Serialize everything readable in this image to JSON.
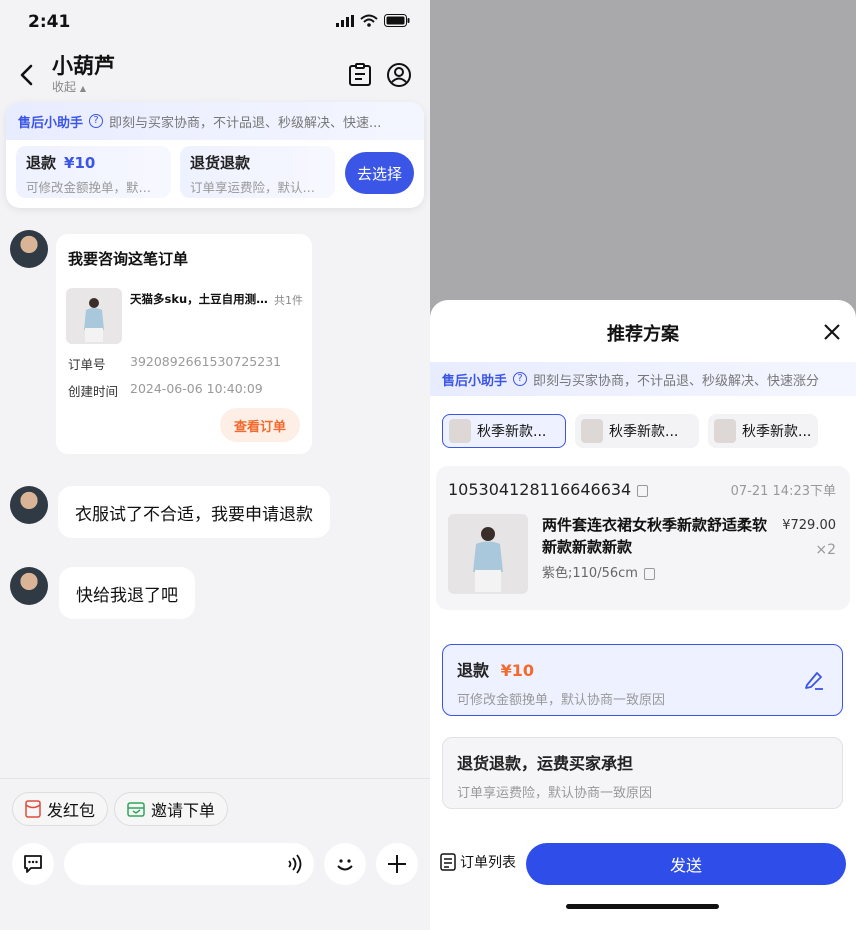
{
  "status_bar": {
    "time": "2:41"
  },
  "header": {
    "title": "小葫芦",
    "subtitle": "收起"
  },
  "helper": {
    "name": "售后小助手",
    "desc": "即刻与买家协商，不计品退、秒级解决、快速...",
    "options": [
      {
        "title": "退款",
        "amount": "¥10",
        "desc": "可修改金额挽单，默认协商一致原因"
      },
      {
        "title": "退货退款",
        "amount": "",
        "desc": "订单享运费险，默认协商一致原因"
      }
    ],
    "choose_label": "去选择"
  },
  "order_card": {
    "title": "我要咨询这笔订单",
    "product_name": "天猫多sku，土豆自用测试商品",
    "count": "共1件",
    "order_no_label": "订单号",
    "order_no": "3920892661530725231",
    "created_label": "创建时间",
    "created": "2024-06-06 10:40:09",
    "view_label": "查看订单"
  },
  "messages": [
    "衣服试了不合适，我要申请退款",
    "快给我退了吧"
  ],
  "quick_actions": [
    "发红包",
    "邀请下单"
  ],
  "sheet": {
    "title": "推荐方案",
    "helper_name": "售后小助手",
    "helper_desc": "即刻与买家协商，不计品退、秒级解决、快速涨分",
    "tabs": [
      "秋季新款...",
      "秋季新款...",
      "秋季新款..."
    ],
    "order": {
      "number": "105304128116646634",
      "time": "07-21 14:23下单",
      "name": "两件套连衣裙女秋季新款舒适柔软新款新款新款",
      "price": "¥729.00",
      "qty": "×2",
      "spec": "紫色;110/56cm"
    },
    "plans": [
      {
        "title": "退款",
        "amount": "¥10",
        "desc": "可修改金额挽单，默认协商一致原因"
      },
      {
        "title": "退货退款，运费买家承担",
        "desc": "订单享运费险，默认协商一致原因"
      }
    ],
    "order_list_label": "订单列表",
    "send_label": "发送"
  },
  "colors": {
    "accent": "#3b55e6",
    "orange": "#f26a2e"
  }
}
